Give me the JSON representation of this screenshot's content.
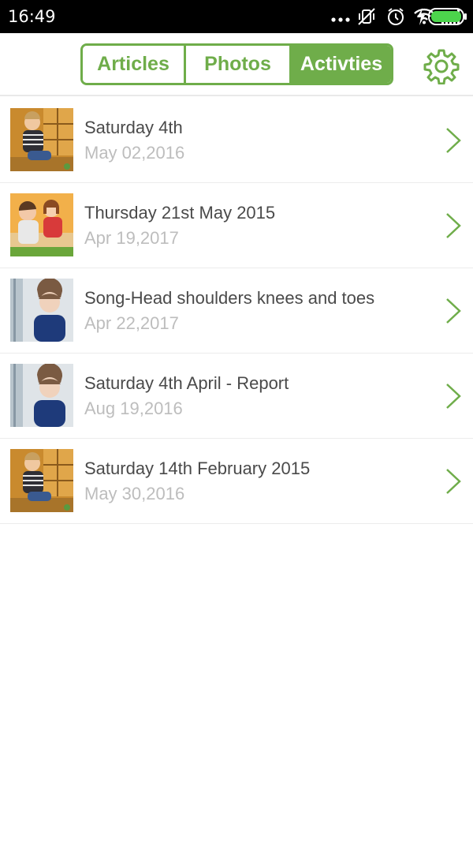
{
  "status_bar": {
    "time": "16:49"
  },
  "theme": {
    "accent": "#6fad4a",
    "title_color": "#4a4a4a",
    "date_color": "#bdbdbd"
  },
  "tabs": [
    {
      "label": "Articles",
      "active": false
    },
    {
      "label": "Photos",
      "active": false
    },
    {
      "label": "Activties",
      "active": true
    }
  ],
  "settings_icon": "gear-icon",
  "items": [
    {
      "title": "Saturday 4th",
      "date": "May 02,2016",
      "thumbnail": "toddler-playing-photo"
    },
    {
      "title": "Thursday 21st May 2015",
      "date": "Apr 19,2017",
      "thumbnail": "two-kids-photo"
    },
    {
      "title": "Song-Head shoulders knees and toes",
      "date": "Apr 22,2017",
      "thumbnail": "child-portrait-photo"
    },
    {
      "title": "Saturday 4th April - Report",
      "date": "Aug 19,2016",
      "thumbnail": "child-portrait-photo"
    },
    {
      "title": "Saturday 14th February 2015",
      "date": "May 30,2016",
      "thumbnail": "toddler-playing-photo"
    }
  ]
}
